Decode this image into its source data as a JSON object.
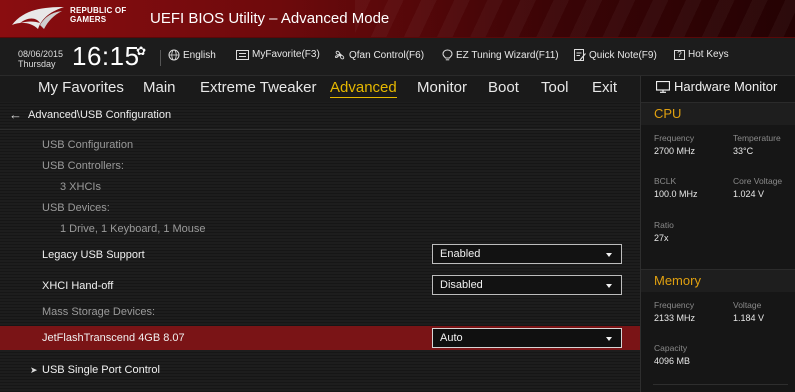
{
  "titlebar": {
    "brand_line1": "REPUBLIC OF",
    "brand_line2": "GAMERS",
    "title": "UEFI BIOS Utility – Advanced Mode"
  },
  "toolbar": {
    "date": "08/06/2015",
    "day": "Thursday",
    "time": "16:15",
    "language": "English",
    "myfavorite": "MyFavorite(F3)",
    "qfan": "Qfan Control(F6)",
    "ez_tuning": "EZ Tuning Wizard(F11)",
    "quick_note": "Quick Note(F9)",
    "hot_keys": "Hot Keys",
    "hot_keys_glyph": "?"
  },
  "menu": {
    "items": [
      "My Favorites",
      "Main",
      "Extreme Tweaker",
      "Advanced",
      "Monitor",
      "Boot",
      "Tool",
      "Exit"
    ],
    "active": "Advanced"
  },
  "breadcrumb": "Advanced\\USB Configuration",
  "rows": {
    "usb_configuration": "USB Configuration",
    "usb_controllers": "USB Controllers:",
    "controllers_value": "3 XHCIs",
    "usb_devices": "USB Devices:",
    "devices_value": "1 Drive, 1 Keyboard, 1 Mouse",
    "legacy_usb": {
      "label": "Legacy USB Support",
      "value": "Enabled"
    },
    "xhci_handoff": {
      "label": "XHCI Hand-off",
      "value": "Disabled"
    },
    "mass_storage": "Mass Storage Devices:",
    "jetflash": {
      "label": "JetFlashTranscend 4GB 8.07",
      "value": "Auto"
    },
    "single_port": "USB Single Port Control"
  },
  "hwmon": {
    "title": "Hardware Monitor",
    "cpu": {
      "section": "CPU",
      "frequency_label": "Frequency",
      "frequency": "2700 MHz",
      "temperature_label": "Temperature",
      "temperature": "33°C",
      "bclk_label": "BCLK",
      "bclk": "100.0 MHz",
      "core_voltage_label": "Core Voltage",
      "core_voltage": "1.024 V",
      "ratio_label": "Ratio",
      "ratio": "27x"
    },
    "memory": {
      "section": "Memory",
      "frequency_label": "Frequency",
      "frequency": "2133 MHz",
      "voltage_label": "Voltage",
      "voltage": "1.184 V",
      "capacity_label": "Capacity",
      "capacity": "4096 MB"
    }
  },
  "colors": {
    "accent": "#e6b800",
    "section": "#e0a010",
    "selected_row": "#7a1416",
    "titlebar": "#8a0d10"
  },
  "icons": {
    "logo": "rog-eye-logo",
    "settings": "gear-icon",
    "language": "globe-icon",
    "favorite": "star-list-icon",
    "qfan": "fan-icon",
    "ez_tuning": "bulb-icon",
    "quick_note": "note-icon",
    "hot_keys": "keyboard-icon",
    "monitor": "monitor-icon"
  }
}
